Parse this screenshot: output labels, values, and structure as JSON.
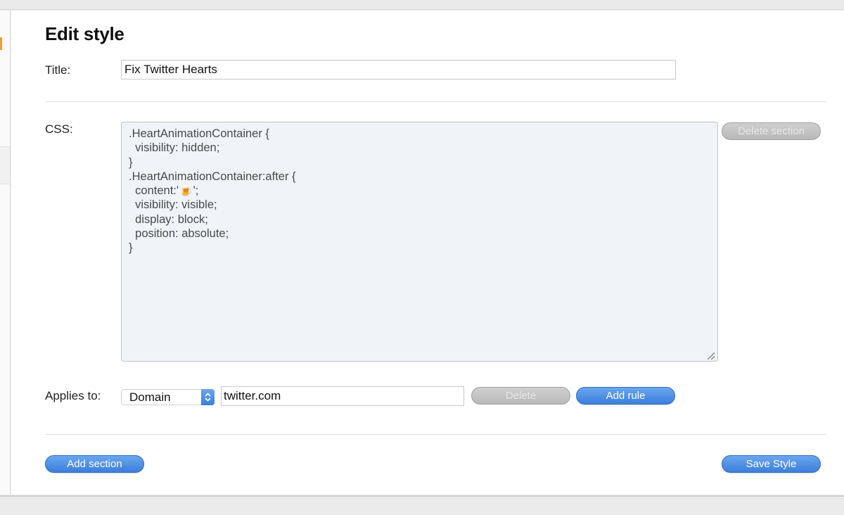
{
  "page": {
    "title": "Edit style"
  },
  "form": {
    "title_label": "Title:",
    "title_value": "Fix Twitter Hearts",
    "css_label": "CSS:",
    "css_code": ".HeartAnimationContainer {\n  visibility: hidden;\n}\n.HeartAnimationContainer:after {\n  content:'🍺';\n  visibility: visible;\n  display: block;\n  position: absolute;\n}",
    "delete_section_label": "Delete section",
    "applies_to_label": "Applies to:",
    "rule_type_selected": "Domain",
    "rule_value": "twitter.com",
    "delete_rule_label": "Delete",
    "add_rule_label": "Add rule"
  },
  "footer": {
    "add_section_label": "Add section",
    "save_style_label": "Save Style"
  },
  "colors": {
    "accent_blue": "#3c7fdc",
    "disabled_gray": "#b9b9b9",
    "code_background": "#f0f3f7"
  }
}
